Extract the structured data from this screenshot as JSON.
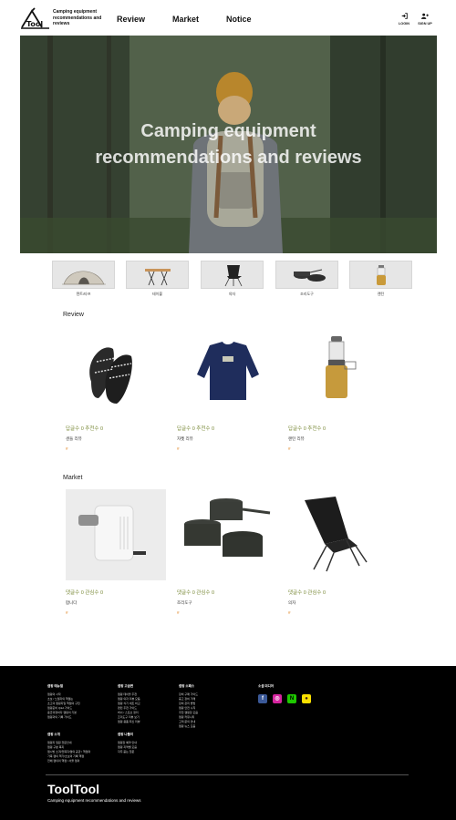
{
  "header": {
    "logo_text": "ToolTool",
    "tagline": "Camping equipment recommendations and reviews",
    "nav": [
      "Review",
      "Market",
      "Notice"
    ],
    "login_label": "LOGIN",
    "signup_label": "SIGN UP"
  },
  "hero": {
    "title_line1": "Camping equipment",
    "title_line2": "recommendations and reviews"
  },
  "categories": [
    "텐트/타프",
    "테이블",
    "의자",
    "조리도구",
    "랜턴"
  ],
  "review": {
    "title": "Review",
    "cards": [
      {
        "stats": "답글수  0  추천수  0",
        "name": "샌들 리뷰",
        "icon": "sandals"
      },
      {
        "stats": "답글수  0  추천수  0",
        "name": "자켓 리뷰",
        "icon": "sweatshirt"
      },
      {
        "stats": "답글수  0  추천수  0",
        "name": "랜턴 리뷰",
        "icon": "gas-lantern"
      }
    ]
  },
  "market": {
    "title": "Market",
    "cards": [
      {
        "stats": "댓글수  0  관심수  0",
        "name": "팝니다",
        "icon": "heater"
      },
      {
        "stats": "댓글수  0  관심수  0",
        "name": "조리도구",
        "icon": "cookware"
      },
      {
        "stats": "댓글수  0  관심수  0",
        "name": "의자",
        "icon": "camping-chair"
      }
    ]
  },
  "card_marker": "#",
  "footer": {
    "col1": {
      "heading": "캠핑 메뉴얼",
      "items": [
        "캠핑의 시작",
        "초보 / 노캠자의 핵캠는",
        "초고의 캠핑지일 핵캠의 구천",
        "캠핑준비 Q&A 가이드",
        "중급과정하다 캠핑의 기본",
        "캠핑과의 기록 가이드"
      ]
    },
    "col2": {
      "heading": "캠핑 소개",
      "items": [
        "캠핑지 일원 전문안내",
        "캠핑 구분 목지",
        "캠시방 소개/전목지/캠의 공관 / 핵캠의",
        "가족 캠의 핵가/초보의 기록 핵캠",
        "전체 캠의의 핵캠 / 서울 캠의"
      ]
    },
    "col3": {
      "heading": "캠핑 고급편",
      "items": [
        "캠핑 테이블 추천",
        "캠핑 의자 리뷰 모음",
        "캠핑 식기 세트 비교",
        "랜턴 추천 가이드",
        "버너 / 스토브 정리",
        "조리도구 리뷰 보기",
        "캠핑 용품 최신 리뷰"
      ]
    },
    "col4": {
      "heading": "캠핑 나들이",
      "items": [
        "캠핑장 예약 안내",
        "캠핑 지역별 모음",
        "자주 묻는 질문"
      ]
    },
    "col5": {
      "heading": "캠핑 소패스",
      "items": [
        "장비 구매 가이드",
        "중고 장비 거래",
        "장비 관리 방법",
        "캠핑 안전 수칙",
        "추천 캠핑장 모음",
        "캠핑 커뮤니티",
        "고객 문의 안내",
        "캠핑 뉴스 모음"
      ]
    },
    "social_title": "소셜 미디어",
    "social": [
      {
        "icon": "facebook-icon",
        "glyph": "f",
        "color": "#3b5998"
      },
      {
        "icon": "instagram-icon",
        "glyph": "◎",
        "color": "#d6249f"
      },
      {
        "icon": "naver-icon",
        "glyph": "N",
        "color": "#1ec800"
      },
      {
        "icon": "kakao-icon",
        "glyph": "●",
        "color": "#f9e000"
      }
    ],
    "brand": "ToolTool",
    "slogan": "Camping equipment recommendations and reviews"
  }
}
